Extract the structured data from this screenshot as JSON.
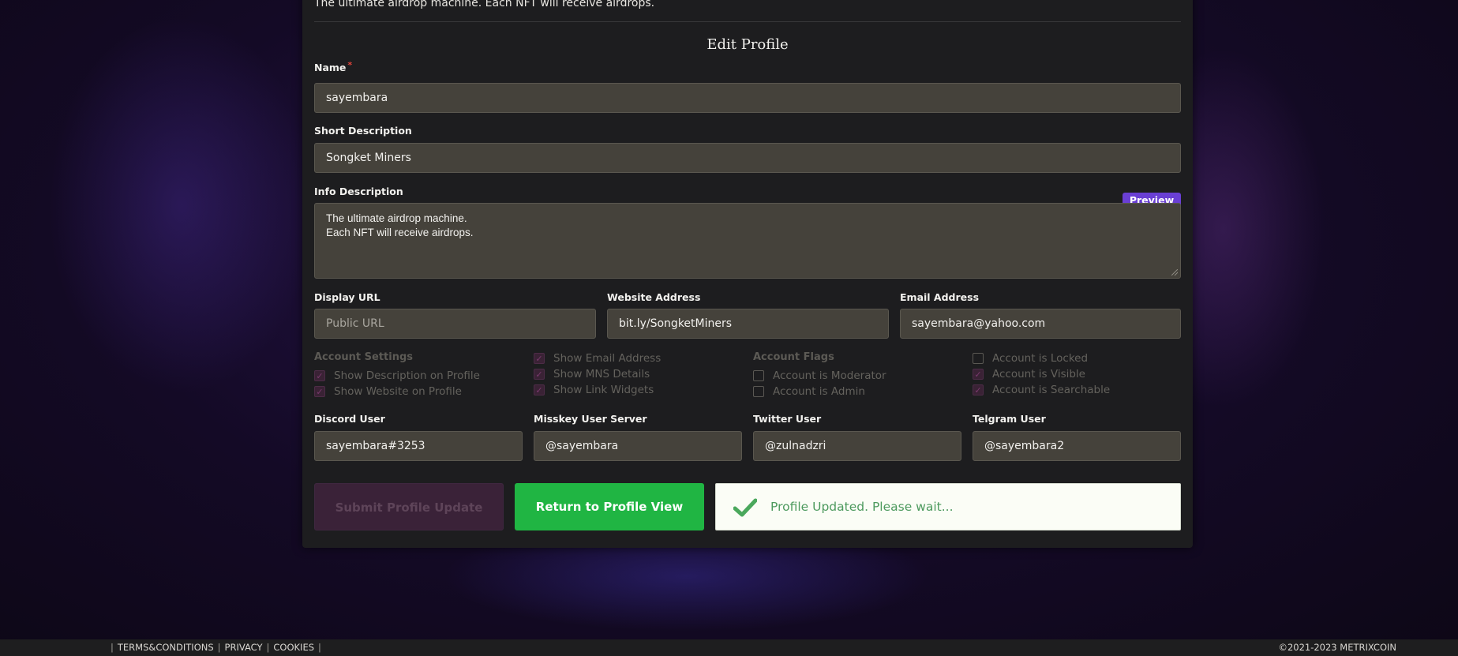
{
  "profile": {
    "top_description": "The ultimate airdrop machine. Each NFT will receive airdrops.",
    "title": "Edit Profile",
    "name": {
      "label": "Name",
      "required_mark": "*",
      "value": "sayembara"
    },
    "short_description": {
      "label": "Short Description",
      "value": "Songket Miners"
    },
    "info_description": {
      "label": "Info Description",
      "preview_label": "Preview",
      "line1": "The ultimate airdrop machine.",
      "line2": "Each NFT will receive airdrops."
    },
    "display_url": {
      "label": "Display URL",
      "placeholder": "Public URL",
      "value": ""
    },
    "website": {
      "label": "Website Address",
      "value": "bit.ly/SongketMiners"
    },
    "email": {
      "label": "Email Address",
      "value": "sayembara@yahoo.com"
    }
  },
  "account_settings": {
    "title": "Account Settings",
    "items": [
      {
        "label": "Show Description on Profile",
        "checked": true
      },
      {
        "label": "Show Website on Profile",
        "checked": true
      }
    ],
    "more_items": [
      {
        "label": "Show Email Address",
        "checked": true
      },
      {
        "label": "Show MNS Details",
        "checked": true
      },
      {
        "label": "Show Link Widgets",
        "checked": true
      }
    ]
  },
  "account_flags": {
    "title": "Account Flags",
    "items": [
      {
        "label": "Account is Moderator",
        "checked": false
      },
      {
        "label": "Account is Admin",
        "checked": false
      }
    ],
    "more_items": [
      {
        "label": "Account is Locked",
        "checked": false
      },
      {
        "label": "Account is Visible",
        "checked": true
      },
      {
        "label": "Account is Searchable",
        "checked": true
      }
    ]
  },
  "social": {
    "discord": {
      "label": "Discord User",
      "value": "sayembara#3253"
    },
    "misskey": {
      "label": "Misskey User Server",
      "value": "@sayembara"
    },
    "twitter": {
      "label": "Twitter User",
      "value": "@zulnadzri"
    },
    "telegram": {
      "label": "Telgram User",
      "value": "@sayembara2"
    }
  },
  "actions": {
    "submit_label": "Submit Profile Update",
    "return_label": "Return to Profile View",
    "status_text": "Profile Updated. Please wait..."
  },
  "footer": {
    "links": [
      "TERMS&CONDITIONS",
      "PRIVACY",
      "COOKIES"
    ],
    "separator": "|",
    "copyright": "©2021-2023 METRIXCOIN"
  },
  "colors": {
    "accent_purple": "#6a3fd4",
    "success_green": "#20b543",
    "status_text": "#4d9a5e",
    "field_bg": "#45423b",
    "panel_bg": "#1d1d1f"
  },
  "icons": {
    "status": "check-icon",
    "checkbox_checked": "checkmark",
    "textarea_handle": "resize-handle-icon"
  }
}
